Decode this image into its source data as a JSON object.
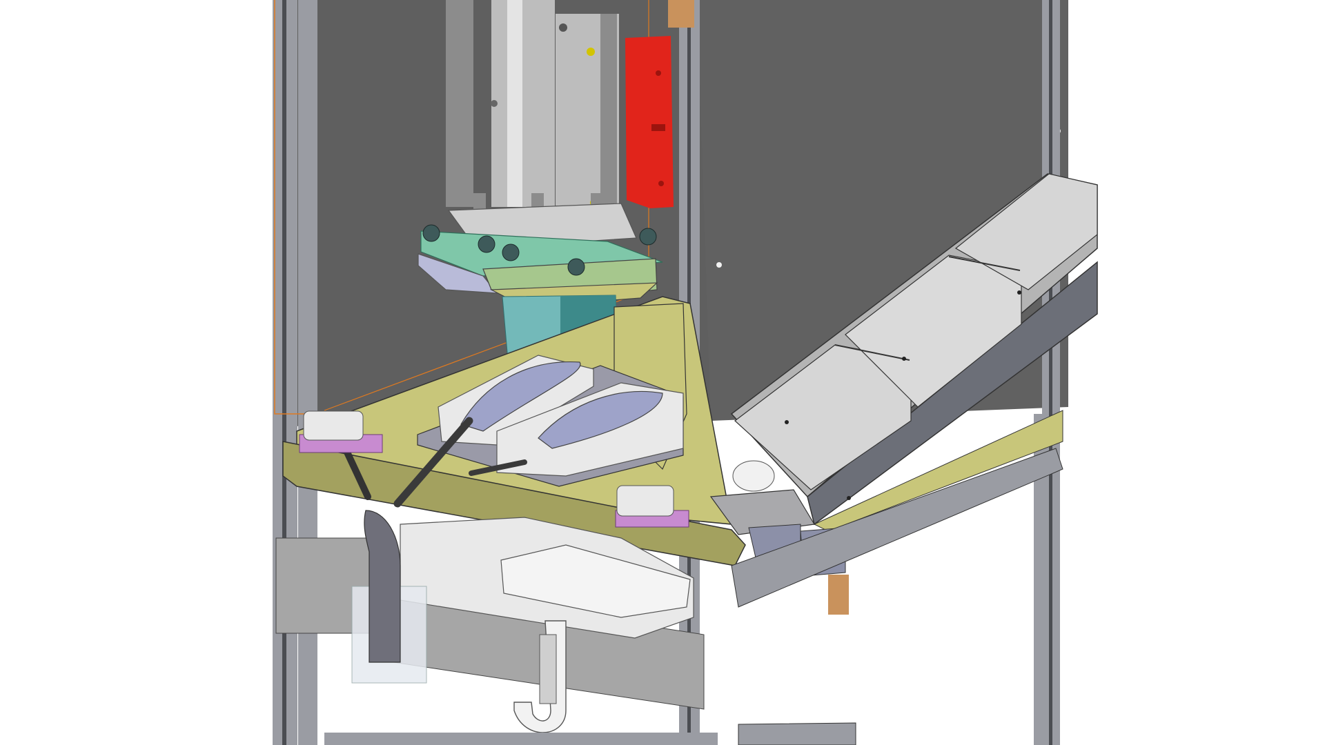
{
  "image": {
    "kind": "3D CAD assembly render",
    "visible_text": []
  },
  "palette": {
    "background": "#ffffff",
    "back_panel": "#5f5f5f",
    "side_panel": "#616161",
    "extrusion": "#9a9ca3",
    "extrusion_dark": "#4b4d52",
    "cylinder": "#bdbdbd",
    "cylinder_dark": "#8c8c8c",
    "red_bracket": "#e1241b",
    "olive_table": "#c8c67a",
    "olive_table_dark": "#a3a15f",
    "teal_column": "#73b9b9",
    "green_plate": "#a6c78d",
    "lavender_plate": "#b9bbd9",
    "purple_pad": "#c88bd0",
    "white_part": "#e9e9e9",
    "wire_orange": "#e07a20",
    "bronze_block": "#c9925c",
    "chute_grey": "#b4b4b4",
    "chute_dark": "#6c6f78",
    "probe_blue": "#9ea3c9"
  }
}
